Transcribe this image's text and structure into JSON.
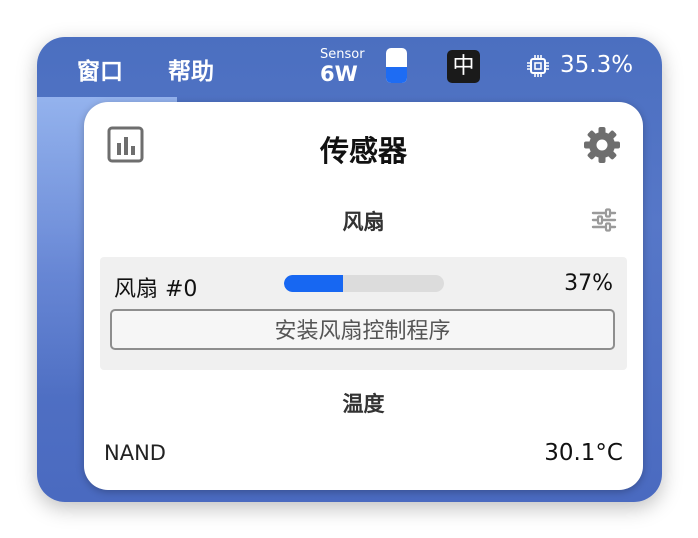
{
  "menubar": {
    "menu_window": "窗口",
    "menu_help": "帮助",
    "sensor_label": "Sensor",
    "sensor_value": "6W",
    "battery_level": 0.45,
    "input_method": "中",
    "cpu_icon": "cpu-chip-icon",
    "cpu_usage": "35.3%"
  },
  "panel": {
    "title": "传感器",
    "left_icon": "bar-chart-icon",
    "right_icon": "gear-icon",
    "fan_section": {
      "title": "风扇",
      "settings_icon": "sliders-icon",
      "fans": [
        {
          "name": "风扇 #0",
          "speed_fraction": 0.37,
          "percent_label": "37%"
        }
      ],
      "install_button_label": "安装风扇控制程序"
    },
    "temperature_section": {
      "title": "温度",
      "sensors": [
        {
          "name": "NAND",
          "value": "30.1°C"
        }
      ]
    }
  },
  "colors": {
    "accent": "#1767f2",
    "desktop_blue": "#4b6fc0",
    "panel_bg": "#ffffff",
    "card_bg": "#f0f0f0",
    "icon_gray": "#6e6e6e"
  }
}
